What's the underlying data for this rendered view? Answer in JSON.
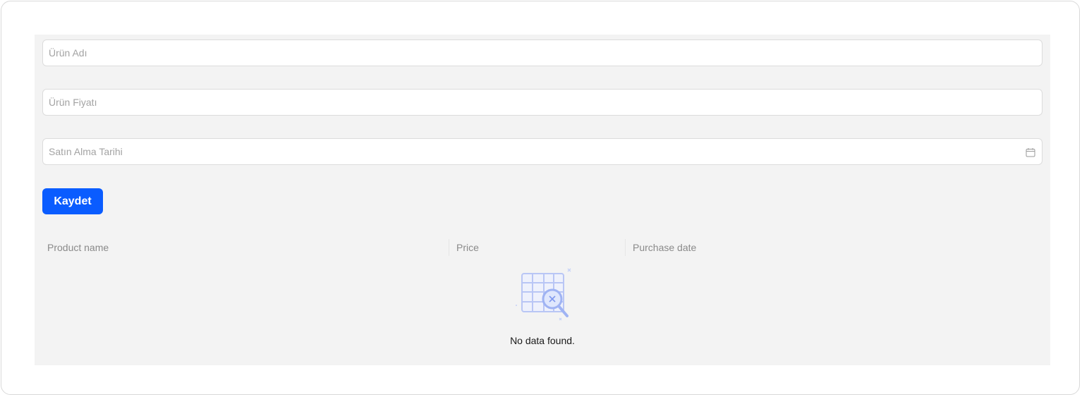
{
  "form": {
    "product_name_placeholder": "Ürün Adı",
    "product_price_placeholder": "Ürün Fiyatı",
    "purchase_date_placeholder": "Satın Alma Tarihi",
    "save_label": "Kaydet"
  },
  "table": {
    "columns": [
      "Product name",
      "Price",
      "Purchase date"
    ],
    "rows": [],
    "empty_message": "No data found."
  },
  "icons": {
    "calendar": "calendar-icon",
    "empty": "no-data-table-search-icon"
  },
  "colors": {
    "primary": "#0a5cff",
    "panel_background": "#f3f3f3",
    "illustration": "#b9c6f5"
  }
}
